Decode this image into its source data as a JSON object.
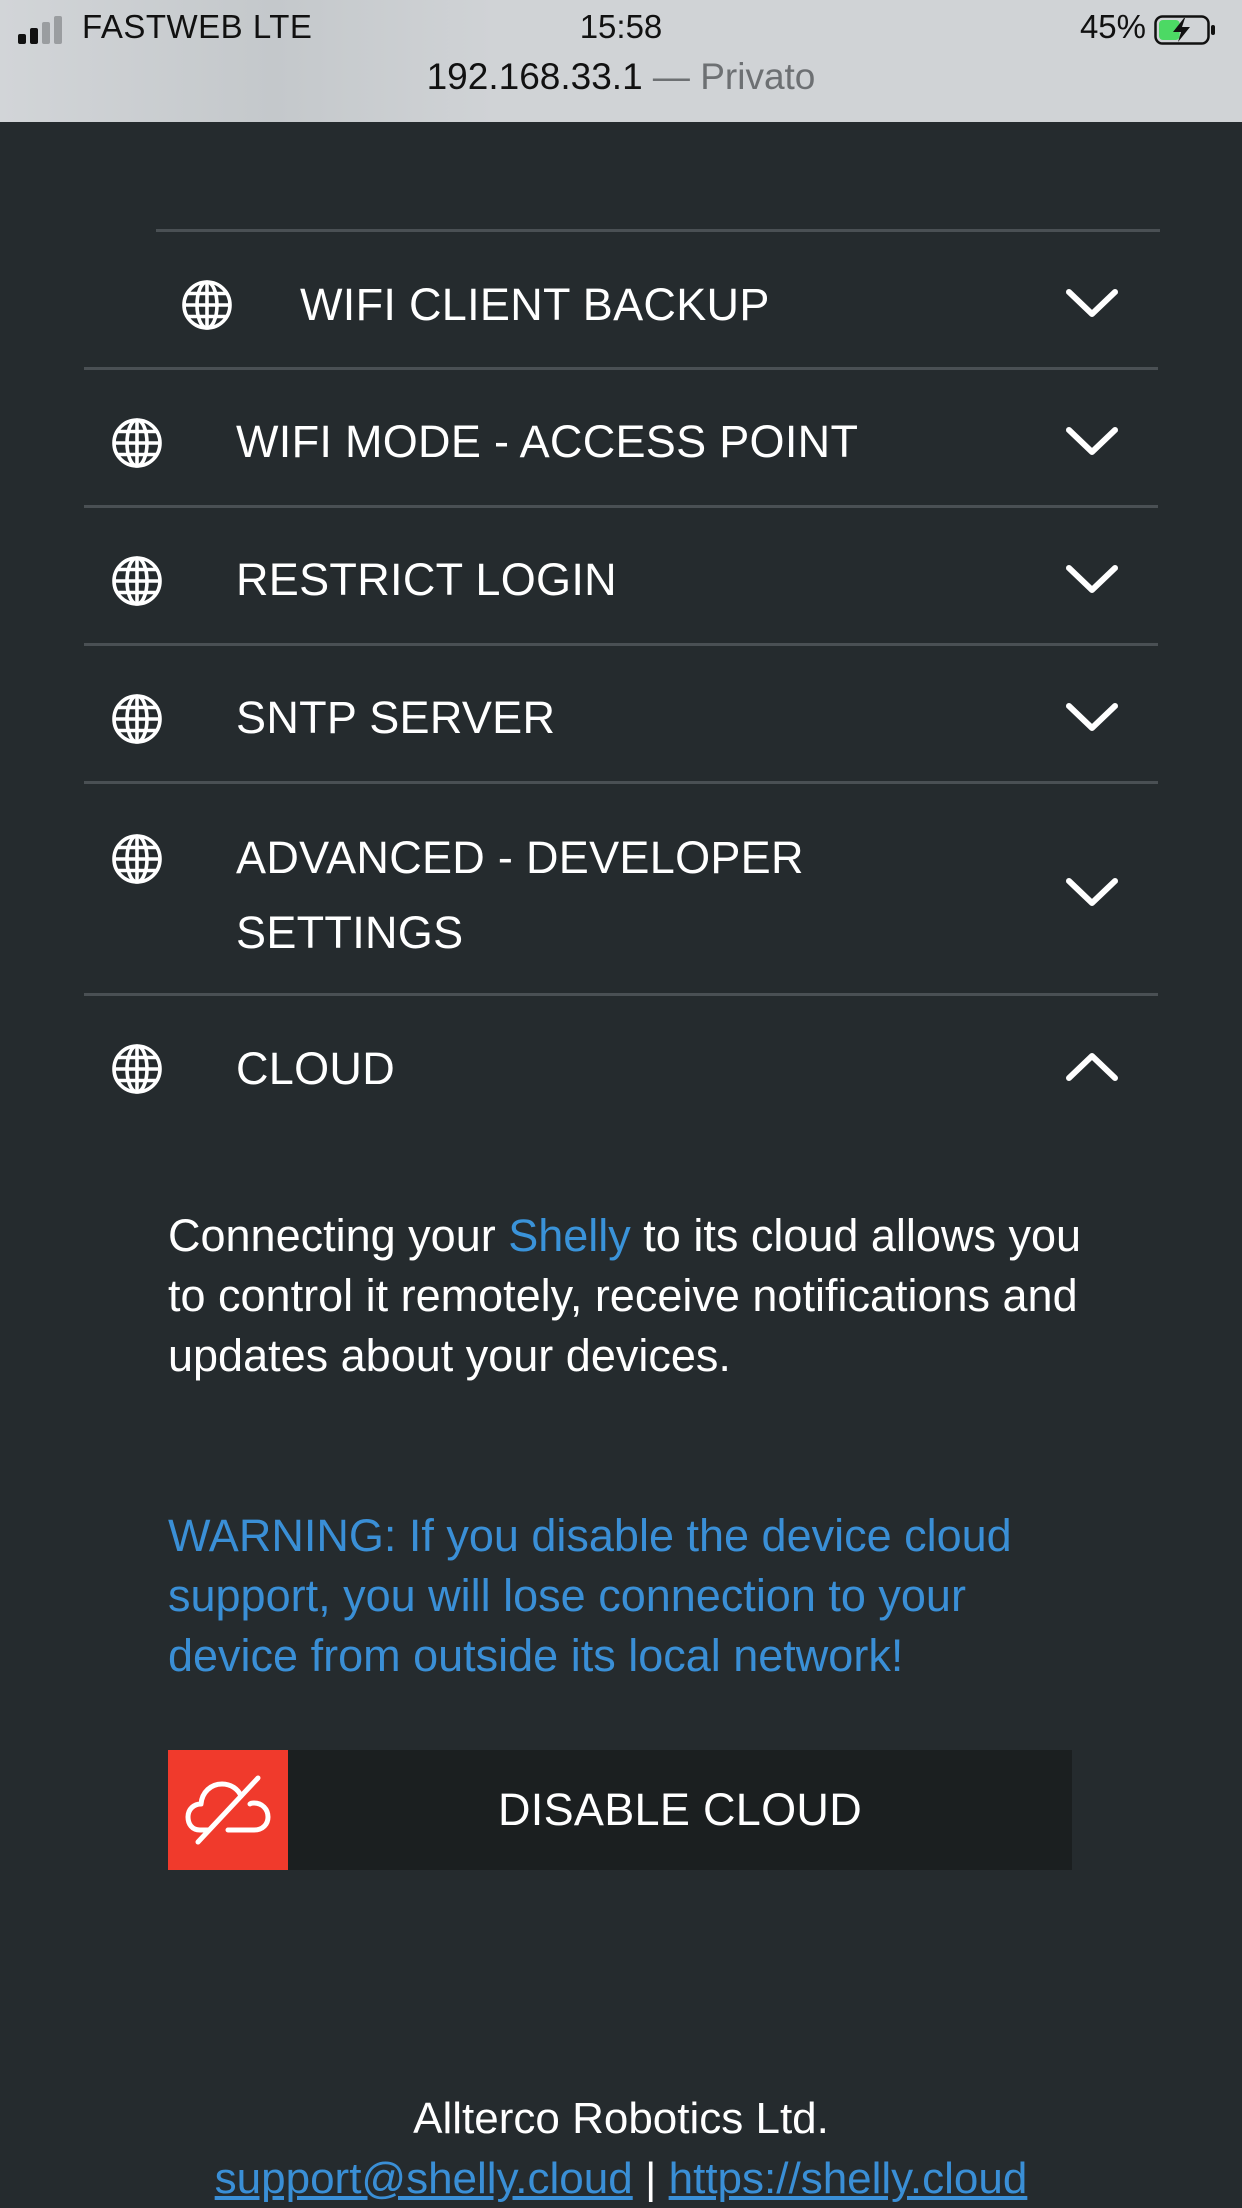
{
  "status_bar": {
    "carrier": "FASTWEB LTE",
    "time": "15:58",
    "battery_percent": "45%",
    "battery_level": 0.45,
    "signal_bars_active": 2,
    "signal_bars_total": 4,
    "charging": true
  },
  "address_bar": {
    "host": "192.168.33.1",
    "separator": " — ",
    "privacy": "Privato"
  },
  "accordion": {
    "sections": [
      {
        "label": "WIFI CLIENT BACKUP",
        "icon": "globe-icon",
        "expanded": false
      },
      {
        "label": "WIFI MODE - ACCESS POINT",
        "icon": "globe-icon",
        "expanded": false
      },
      {
        "label": "RESTRICT LOGIN",
        "icon": "globe-icon",
        "expanded": false
      },
      {
        "label": "SNTP SERVER",
        "icon": "globe-icon",
        "expanded": false
      },
      {
        "label_line1": "ADVANCED - DEVELOPER",
        "label_line2": "SETTINGS",
        "icon": "globe-icon",
        "expanded": false
      },
      {
        "label": "CLOUD",
        "icon": "globe-icon",
        "expanded": true
      }
    ]
  },
  "cloud": {
    "intro_before": "Connecting your ",
    "intro_brand": "Shelly",
    "intro_after": " to its cloud allows you to control it remotely, receive notifications and updates about your devices.",
    "warning": "WARNING: If you disable the device cloud support, you will lose connection to your device from outside its local network!",
    "disable_button_label": "DISABLE CLOUD",
    "disable_button_icon": "cloud-off-icon"
  },
  "footer": {
    "company": "Allterco Robotics Ltd.",
    "support_email": "support@shelly.cloud",
    "divider": " | ",
    "website": "https://shelly.cloud"
  },
  "colors": {
    "page_background": "#252b2e",
    "divider": "#4a5054",
    "accent_blue": "#3a8fd6",
    "button_background": "#1b1f20",
    "button_icon_background": "#f03a2c",
    "battery_green": "#4cd964"
  }
}
